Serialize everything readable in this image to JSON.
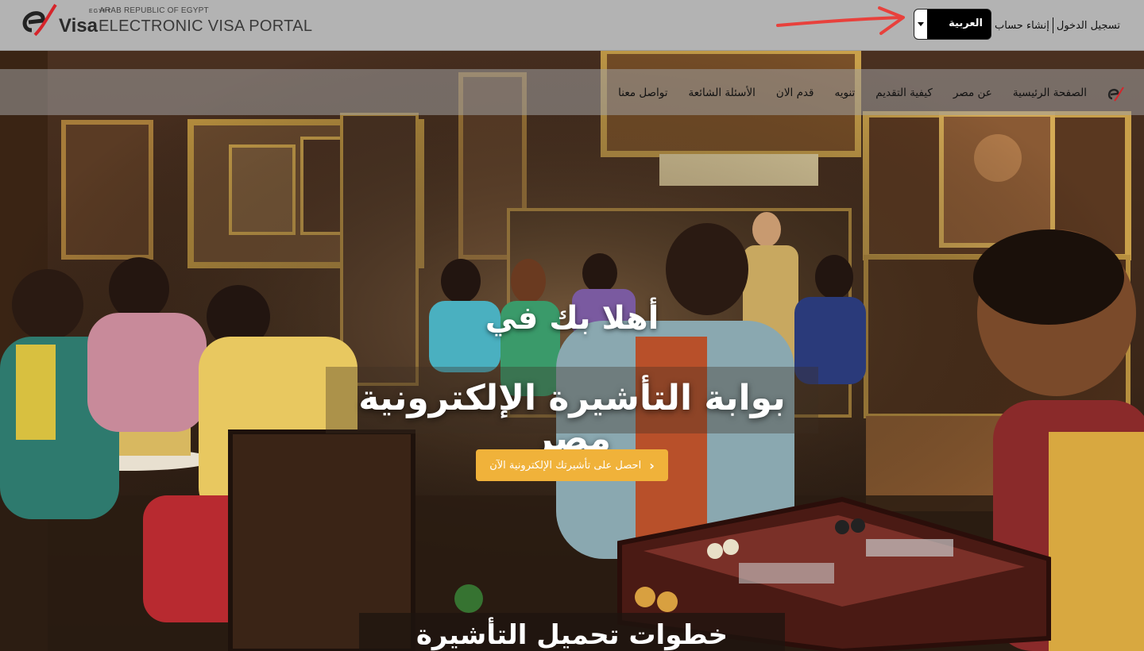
{
  "header": {
    "logo_egypt": "EGYPT",
    "logo_visa": "Visa",
    "portal_subtitle": "ARAB REPUBLIC OF EGYPT",
    "portal_title": "ELECTRONIC VISA PORTAL",
    "language_selected": "العربية",
    "login_label": "تسجيل الدخول",
    "register_label": "إنشاء حساب"
  },
  "nav": {
    "items": [
      {
        "label": "الصفحة الرئيسية"
      },
      {
        "label": "عن مصر"
      },
      {
        "label": "كيفية التقديم"
      },
      {
        "label": "تنويه"
      },
      {
        "label": "قدم الان"
      },
      {
        "label": "الأسئلة الشائعة"
      },
      {
        "label": "تواصل معنا"
      }
    ]
  },
  "hero": {
    "welcome": "أهلا بك في",
    "title": "بوابة التأشيرة الإلكترونية مصر",
    "cta_label": "احصل على تأشيرتك الإلكترونية الآن",
    "steps_heading": "خطوات تحميل التأشيرة الالكترونية"
  },
  "colors": {
    "topbar": "#b3b3b3",
    "cta": "#f0b23a",
    "annotation_arrow": "#e8413c",
    "brand_red": "#d6242a"
  }
}
